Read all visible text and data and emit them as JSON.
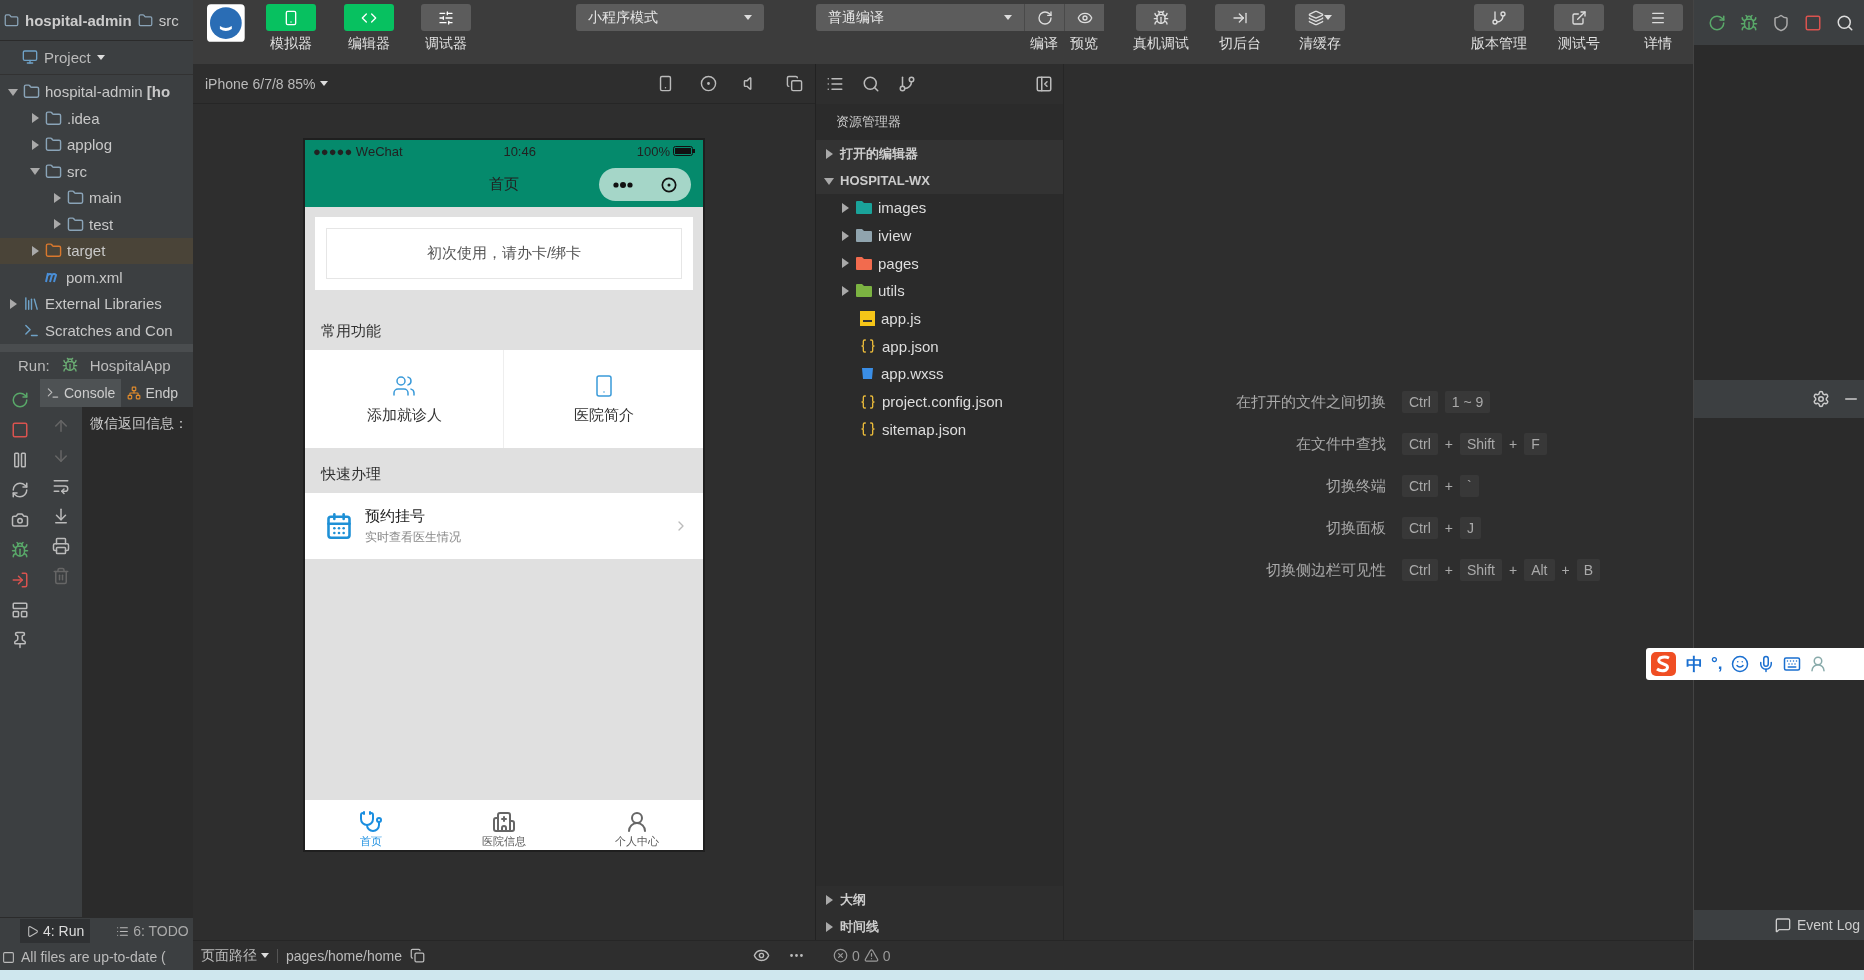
{
  "ide_left": {
    "breadcrumb": [
      {
        "label": "hospital-admin"
      },
      {
        "label": "src"
      }
    ],
    "project_label": "Project",
    "tree": [
      {
        "label": "hospital-admin **[ho**",
        "kind": "module",
        "expanded": true,
        "selected": false,
        "children": [
          {
            "label": ".idea",
            "kind": "folder",
            "expanded": false,
            "selected": false
          },
          {
            "label": "applog",
            "kind": "folder",
            "expanded": false,
            "selected": false
          },
          {
            "label": "src",
            "kind": "folder",
            "expanded": true,
            "selected": false,
            "children": [
              {
                "label": "main",
                "kind": "folder",
                "expanded": false,
                "selected": false
              },
              {
                "label": "test",
                "kind": "folder",
                "expanded": false,
                "selected": false
              }
            ]
          },
          {
            "label": "target",
            "kind": "excluded",
            "expanded": false,
            "selected": true
          },
          {
            "label": "pom.xml",
            "kind": "maven",
            "selected": false
          }
        ]
      },
      {
        "label": "External Libraries",
        "kind": "library",
        "expanded": false,
        "selected": false
      },
      {
        "label": "Scratches and Con",
        "kind": "scratch",
        "selected": false
      }
    ],
    "run": {
      "label": "Run:",
      "config": "HospitalApp",
      "tabs": [
        {
          "label": "Console",
          "selected": true
        },
        {
          "label": "Endp",
          "selected": false
        }
      ],
      "output": "微信返回信息："
    },
    "bottom_tabs": [
      {
        "label": "4: Run",
        "selected": true
      },
      {
        "label": "6: TODO",
        "selected": false
      }
    ],
    "status": "All files are up-to-date ("
  },
  "devtools": {
    "view_buttons": [
      {
        "label": "模拟器",
        "on": true
      },
      {
        "label": "编辑器",
        "on": true
      },
      {
        "label": "调试器",
        "on": false
      }
    ],
    "mode_select": "小程序模式",
    "compile_select": "普通编译",
    "compile_buttons": [
      {
        "label": "编译"
      },
      {
        "label": "预览"
      }
    ],
    "tool_buttons": [
      {
        "label": "真机调试"
      },
      {
        "label": "切后台"
      },
      {
        "label": "清缓存"
      }
    ],
    "right_buttons": [
      {
        "label": "版本管理"
      },
      {
        "label": "测试号"
      },
      {
        "label": "详情"
      }
    ],
    "device_select": "iPhone 6/7/8 85%",
    "phone": {
      "carrier": "●●●●● WeChat",
      "time": "10:46",
      "battery": "100%",
      "nav_title": "首页",
      "card_button": "初次使用，请办卡/绑卡",
      "sections": [
        {
          "title": "常用功能",
          "kind": "grid",
          "items": [
            {
              "label": "添加就诊人"
            },
            {
              "label": "医院简介"
            }
          ]
        },
        {
          "title": "快速办理",
          "kind": "list",
          "items": [
            {
              "label": "预约挂号",
              "subtitle": "实时查看医生情况"
            }
          ]
        }
      ],
      "tabbar": [
        {
          "label": "首页",
          "selected": true
        },
        {
          "label": "医院信息",
          "selected": false
        },
        {
          "label": "个人中心",
          "selected": false
        }
      ]
    },
    "explorer": {
      "title": "资源管理器",
      "sections": [
        {
          "label": "打开的编辑器",
          "expanded": false
        },
        {
          "label": "HOSPITAL-WX",
          "expanded": true
        }
      ],
      "files": [
        {
          "label": "images",
          "kind": "folder",
          "color": "#1aa39a"
        },
        {
          "label": "iview",
          "kind": "folder",
          "color": "#90a4ae"
        },
        {
          "label": "pages",
          "kind": "folder",
          "color": "#f26b4e"
        },
        {
          "label": "utils",
          "kind": "folder",
          "color": "#7cb342"
        },
        {
          "label": "app.js",
          "kind": "js"
        },
        {
          "label": "app.json",
          "kind": "json"
        },
        {
          "label": "app.wxss",
          "kind": "wxss"
        },
        {
          "label": "project.config.json",
          "kind": "json"
        },
        {
          "label": "sitemap.json",
          "kind": "json"
        }
      ],
      "bottom_sections": [
        {
          "label": "大纲",
          "expanded": false
        },
        {
          "label": "时间线",
          "expanded": false
        }
      ],
      "errors": "0",
      "warnings": "0"
    },
    "shortcuts": [
      {
        "label": "在打开的文件之间切换",
        "keys": [
          {
            "kind": "key",
            "label": "Ctrl"
          },
          {
            "kind": "key",
            "label": "1 ~ 9"
          }
        ]
      },
      {
        "label": "在文件中查找",
        "keys": [
          {
            "kind": "key",
            "label": "Ctrl"
          },
          {
            "kind": "plus",
            "label": "+"
          },
          {
            "kind": "key",
            "label": "Shift"
          },
          {
            "kind": "plus",
            "label": "+"
          },
          {
            "kind": "key",
            "label": "F"
          }
        ]
      },
      {
        "label": "切换终端",
        "keys": [
          {
            "kind": "key",
            "label": "Ctrl"
          },
          {
            "kind": "plus",
            "label": "+"
          },
          {
            "kind": "key",
            "label": "`"
          }
        ]
      },
      {
        "label": "切换面板",
        "keys": [
          {
            "kind": "key",
            "label": "Ctrl"
          },
          {
            "kind": "plus",
            "label": "+"
          },
          {
            "kind": "key",
            "label": "J"
          }
        ]
      },
      {
        "label": "切换侧边栏可见性",
        "keys": [
          {
            "kind": "key",
            "label": "Ctrl"
          },
          {
            "kind": "plus",
            "label": "+"
          },
          {
            "kind": "key",
            "label": "Shift"
          },
          {
            "kind": "plus",
            "label": "+"
          },
          {
            "kind": "key",
            "label": "Alt"
          },
          {
            "kind": "plus",
            "label": "+"
          },
          {
            "kind": "key",
            "label": "B"
          }
        ]
      }
    ],
    "status_bar": {
      "path_label": "页面路径",
      "path": "pages/home/home"
    }
  },
  "ide_right": {
    "event_log": "Event Log"
  },
  "ime_bar": {
    "mode": "中",
    "punctuation": "°,"
  }
}
